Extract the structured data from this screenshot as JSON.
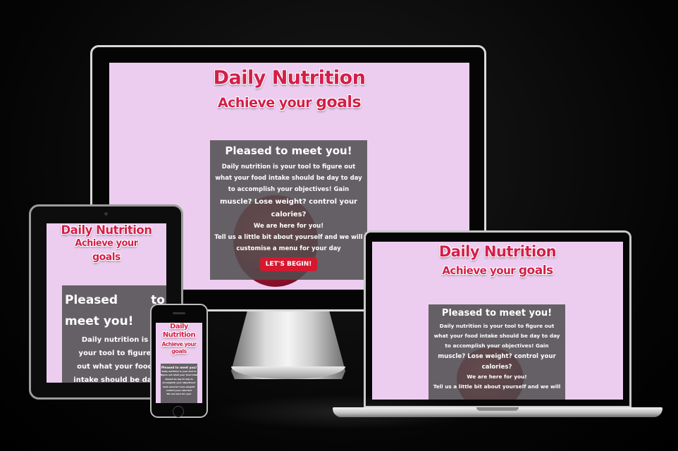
{
  "site": {
    "title": "Daily Nutrition",
    "subtitle_main": "Achieve your",
    "subtitle_emphasis": "goals",
    "greeting": "Pleased to meet you!",
    "greeting_tablet_line1": "Pleased to",
    "greeting_tablet_line2": "meet you!",
    "intro_line1": "Daily nutrition is your tool to figure out",
    "intro_line2": "what your food intake should be day to day",
    "intro_line3": "to accomplish your objectives! Gain",
    "intro_line4": "muscle? Lose weight? control your",
    "intro_line5": "calories?",
    "support": "We are here for you!",
    "cta_text_line1": "Tell us a little bit about yourself and we will",
    "cta_text_line2": "customise a menu for your day",
    "cta_button": "LET'S BEGIN!",
    "tablet_intro_lines": [
      "Daily nutrition is",
      "your tool to figure",
      "out what your food",
      "intake should be day"
    ],
    "phone_intro_lines": [
      "Daily nutrition is your tool to",
      "figure out what your food intake",
      "should be day to day to",
      "accomplish your objectives!",
      "Gain muscle? Lose weight?",
      "control your calories?",
      "We are here for you!"
    ],
    "phone_title_line1": "Daily",
    "phone_title_line2": "Nutrition",
    "phone_subtitle_line1": "Achieve your",
    "phone_subtitle_line2": "goals"
  },
  "colors": {
    "background": "#000000",
    "site_bg": "#eccdf0",
    "brand_red": "#d41e4a",
    "panel": "#4e4e4e",
    "button": "#d4192f"
  }
}
